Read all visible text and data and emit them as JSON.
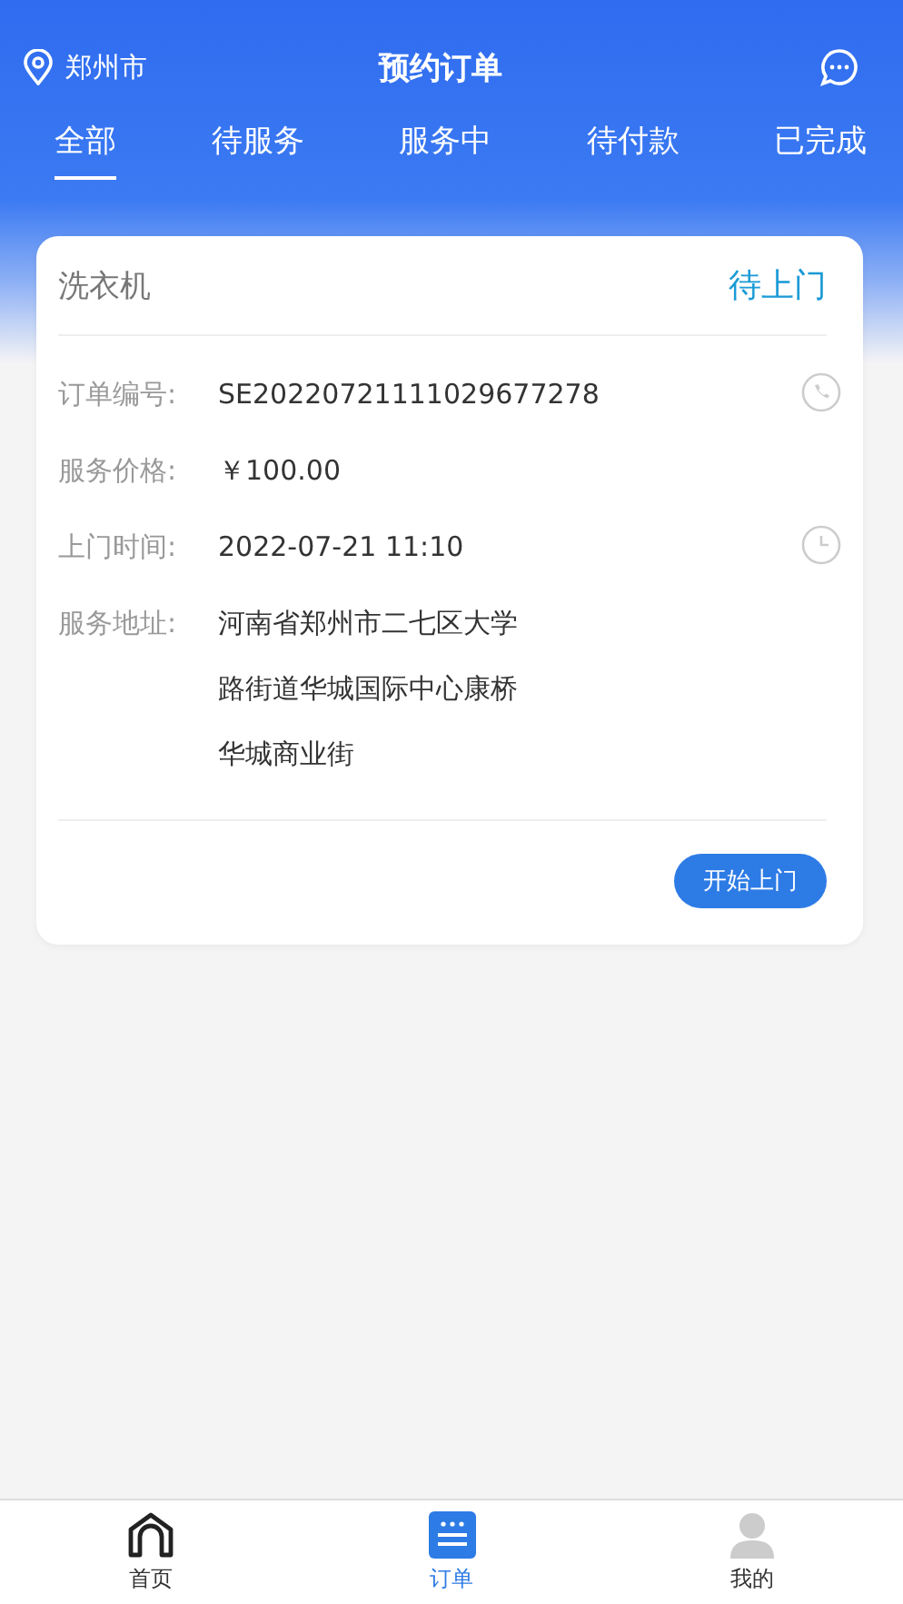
{
  "header": {
    "city": "郑州市",
    "title": "预约订单"
  },
  "tabs": [
    {
      "label": "全部",
      "selected": true
    },
    {
      "label": "待服务",
      "selected": false
    },
    {
      "label": "服务中",
      "selected": false
    },
    {
      "label": "待付款",
      "selected": false
    },
    {
      "label": "已完成",
      "selected": false
    }
  ],
  "orders": [
    {
      "name": "洗衣机",
      "status": "待上门",
      "fields": [
        {
          "label": "订单编号:",
          "value": "SE20220721111029677278",
          "kind": "phone"
        },
        {
          "label": "服务价格:",
          "value": "￥100.00",
          "kind": "price"
        },
        {
          "label": "上门时间:",
          "value": "2022-07-21 11:10",
          "kind": "time"
        },
        {
          "label": "服务地址:",
          "value": "河南省郑州市二七区大学路街道华城国际中心康桥华城商业街",
          "kind": "address"
        }
      ],
      "action": "开始上门"
    }
  ],
  "nav": [
    {
      "label": "首页",
      "kind": "home",
      "selected": false
    },
    {
      "label": "订单",
      "kind": "orders",
      "selected": true
    },
    {
      "label": "我的",
      "kind": "profile",
      "selected": false
    }
  ]
}
